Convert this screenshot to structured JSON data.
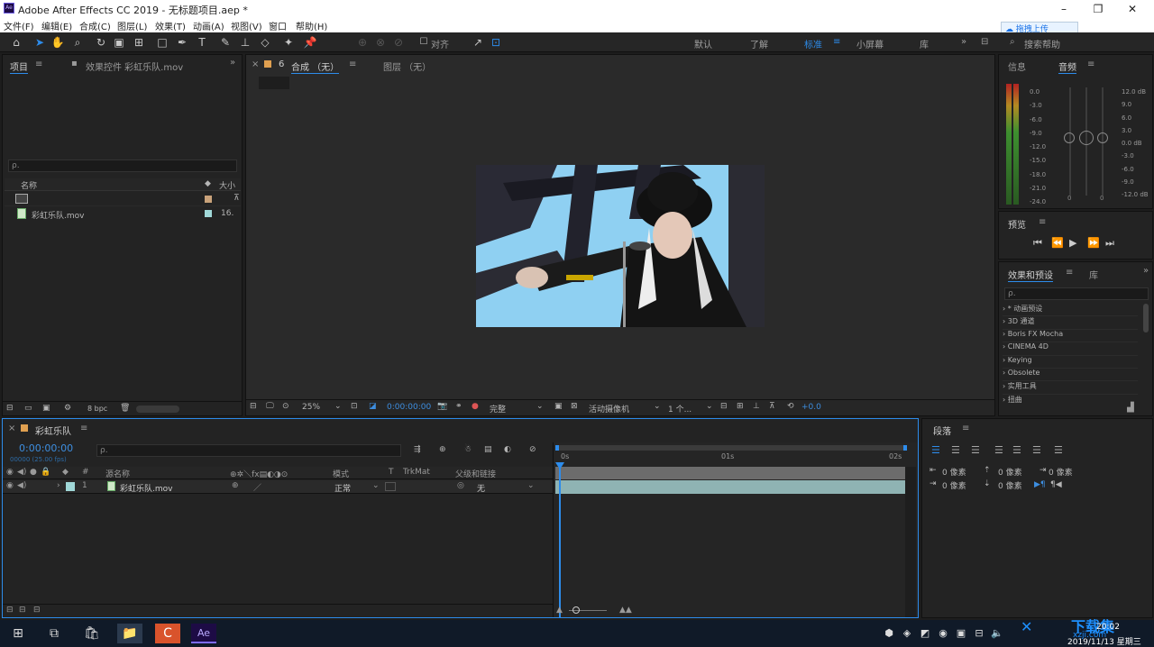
{
  "window": {
    "title": "Adobe After Effects CC 2019 - 无标题项目.aep *",
    "app_icon": "Ae"
  },
  "menus": [
    "文件(F)",
    "编辑(E)",
    "合成(C)",
    "图层(L)",
    "效果(T)",
    "动画(A)",
    "视图(V)",
    "窗口",
    "帮助(H)"
  ],
  "cloud_button": "拖拽上传",
  "toolbar": {
    "align_label": "对齐",
    "workspaces": [
      "默认",
      "了解",
      "标准",
      "小屏幕",
      "库"
    ],
    "active_workspace": "标准",
    "search_help": "搜索帮助"
  },
  "project_panel": {
    "tab_project": "项目",
    "tab_effects": "效果控件 彩虹乐队.mov",
    "search_placeholder": "ρ.",
    "col_name": "名称",
    "col_size": "大小",
    "items": [
      {
        "name": "",
        "icon": "composition-icon",
        "size": ""
      },
      {
        "name": "彩虹乐队.mov",
        "icon": "footage-icon",
        "size": "16."
      }
    ],
    "bpc": "8 bpc"
  },
  "composition_panel": {
    "tab_close": "×",
    "tab_label": "合成 （无）",
    "tab_number": "6",
    "layer_tab": "图层 （无）",
    "zoom": "25%",
    "timecode": "0:00:00:00",
    "resolution": "完整",
    "camera": "活动摄像机",
    "views": "1 个...",
    "exposure": "+0.0"
  },
  "info_panel": {
    "tab_info": "信息",
    "tab_audio": "音频",
    "left_scale": [
      "0.0",
      "-3.0",
      "-6.0",
      "-9.0",
      "-12.0",
      "-15.0",
      "-18.0",
      "-21.0",
      "-24.0"
    ],
    "right_scale": [
      "12.0 dB",
      "9.0",
      "6.0",
      "3.0",
      "0.0 dB",
      "-3.0",
      "-6.0",
      "-9.0",
      "-12.0 dB"
    ],
    "slider_zero_left": "0",
    "slider_zero_right": "0"
  },
  "preview_panel": {
    "title": "预览"
  },
  "effects_panel": {
    "tab_effects": "效果和预设",
    "tab_library": "库",
    "search_placeholder": "ρ.",
    "items": [
      "* 动画预设",
      "3D 通道",
      "Boris FX Mocha",
      "CINEMA 4D",
      "Keying",
      "Obsolete",
      "实用工具",
      "扭曲"
    ]
  },
  "timeline": {
    "tab_label": "彩虹乐队",
    "timecode": "0:00:00:00",
    "timecode_sub": "00000 (25.00 fps)",
    "search_placeholder": "ρ.",
    "col_source": "源名称",
    "col_mode": "模式",
    "col_t": "T",
    "col_trkmat": "TrkMat",
    "col_parent": "父级和链接",
    "layer": {
      "number": "1",
      "name": "彩虹乐队.mov",
      "mode": "正常",
      "parent": "无"
    },
    "ruler": [
      "0s",
      "01s",
      "02s"
    ]
  },
  "paragraph_panel": {
    "title": "段落",
    "spacing": [
      "0 像素",
      "0 像素",
      "0 像素",
      "0 像素",
      "0 像素"
    ]
  },
  "taskbar": {
    "time": "20:02",
    "date": "2019/11/13 星期三",
    "watermark_top": "下载集",
    "watermark_bottom": "xzji.com"
  },
  "colors": {
    "accent": "#2d8ceb",
    "panel": "#232323",
    "bg": "#1d1d1d"
  }
}
